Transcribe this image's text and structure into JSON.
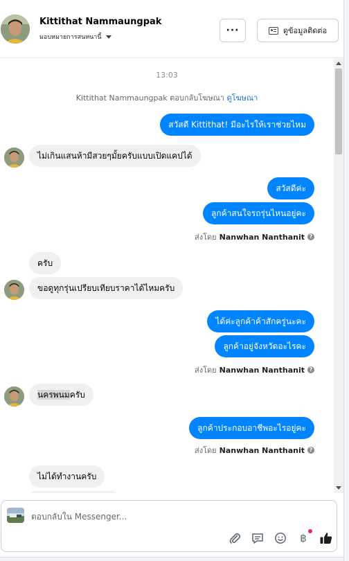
{
  "header": {
    "name": "Kittithat Nammaungpak",
    "assign_label": "มอบหมายการสนทนานี้",
    "more_label": "···",
    "contact_label": "ดูข้อมูลติดต่อ"
  },
  "chat": {
    "timestamp": "13:03",
    "reply_note": {
      "text": "Kittithat Nammaungpak ตอบกลับโฆษณา",
      "link": "ดูโฆษณา"
    },
    "messages": [
      {
        "dir": "out",
        "text": "สวัสดี Kittithat! มีอะไรให้เราช่วยไหม"
      },
      {
        "dir": "in",
        "text": "ไม่เกินแสนห้ามีสวยๆมั้ยครับแบบเปิดแคปได้"
      },
      {
        "dir": "out",
        "text": "สวัสดีค่ะ"
      },
      {
        "dir": "out",
        "text": "ลูกค้าสนใจรถรุ่นไหนอยู่คะ"
      },
      {
        "dir": "in",
        "text": "ครับ"
      },
      {
        "dir": "in",
        "text": "ขอดูทุกรุ่นเปรียบเทียบราคาได้ไหมครับ"
      },
      {
        "dir": "out",
        "text": "ได้ค่ะลูกค้าค้าสักครู่นะคะ"
      },
      {
        "dir": "out",
        "text": "ลูกค้าอยู่จังหวัดอะไรคะ"
      },
      {
        "dir": "in",
        "text_highlight": "นครพนม",
        "text_rest": "ครับ"
      },
      {
        "dir": "out",
        "text": "ลูกค้าประกอบอาชีพอะไรอยู่คะ"
      },
      {
        "dir": "in",
        "text": "ไม่ได้ทำงานครับ"
      }
    ],
    "sent_by_prefix": "ส่งโดย",
    "sent_by_name": "Nanwhan Nanthanit",
    "help_glyph": "?"
  },
  "composer": {
    "placeholder": "ตอบกลับใน Messenger...",
    "icons": [
      "attach-icon",
      "saved-reply-icon",
      "emoji-icon",
      "baht-icon",
      "like-icon"
    ],
    "baht_glyph": "฿"
  },
  "colors": {
    "outgoing_bubble": "#0084ff",
    "incoming_bubble": "#f0f0f0",
    "link": "#216fdb",
    "badge": "#f02849"
  }
}
